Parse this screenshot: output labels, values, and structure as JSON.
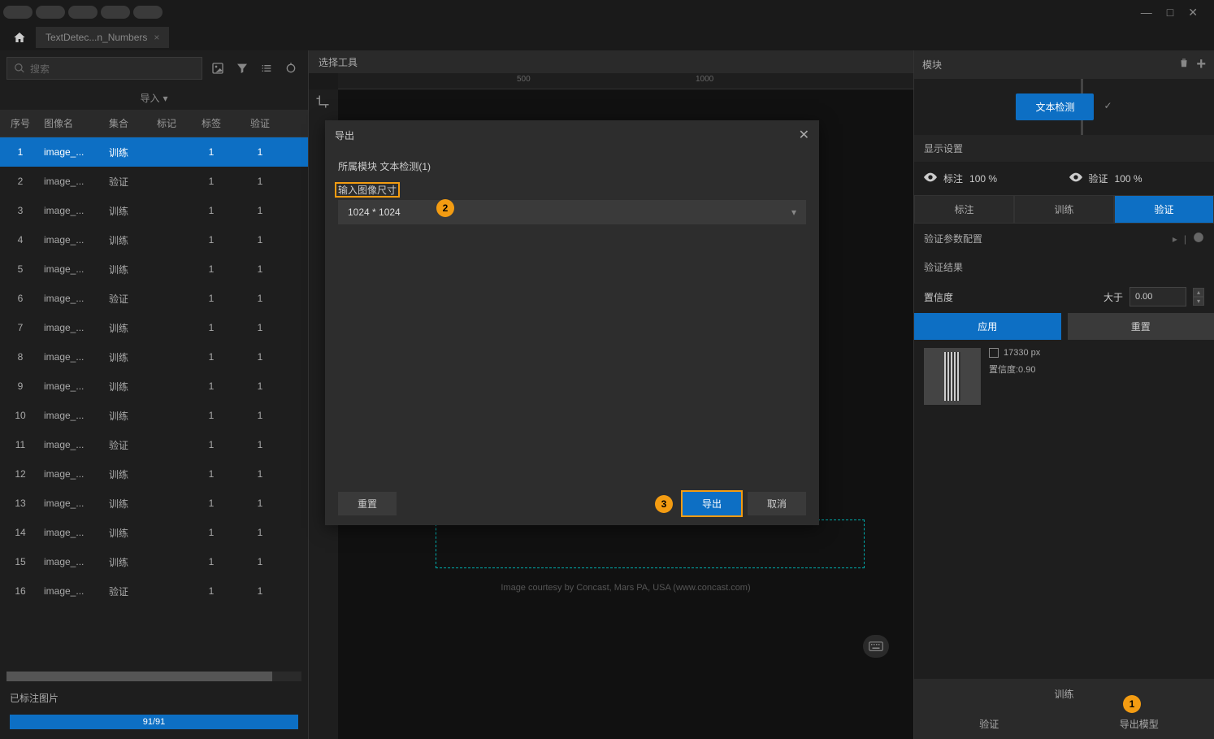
{
  "window": {
    "minimize_label": "—",
    "maximize_label": "□",
    "close_label": "✕"
  },
  "tabs": {
    "active": "TextDetec...n_Numbers"
  },
  "search": {
    "placeholder": "搜索"
  },
  "import_label": "导入",
  "table": {
    "headers": {
      "index": "序号",
      "name": "图像名",
      "set": "集合",
      "mark": "标记",
      "tag": "标签",
      "verify": "验证"
    },
    "rows": [
      {
        "idx": "1",
        "name": "image_...",
        "set": "训练",
        "tag": "1",
        "verify": "1",
        "selected": true
      },
      {
        "idx": "2",
        "name": "image_...",
        "set": "验证",
        "tag": "1",
        "verify": "1"
      },
      {
        "idx": "3",
        "name": "image_...",
        "set": "训练",
        "tag": "1",
        "verify": "1"
      },
      {
        "idx": "4",
        "name": "image_...",
        "set": "训练",
        "tag": "1",
        "verify": "1"
      },
      {
        "idx": "5",
        "name": "image_...",
        "set": "训练",
        "tag": "1",
        "verify": "1"
      },
      {
        "idx": "6",
        "name": "image_...",
        "set": "验证",
        "tag": "1",
        "verify": "1"
      },
      {
        "idx": "7",
        "name": "image_...",
        "set": "训练",
        "tag": "1",
        "verify": "1"
      },
      {
        "idx": "8",
        "name": "image_...",
        "set": "训练",
        "tag": "1",
        "verify": "1"
      },
      {
        "idx": "9",
        "name": "image_...",
        "set": "训练",
        "tag": "1",
        "verify": "1"
      },
      {
        "idx": "10",
        "name": "image_...",
        "set": "训练",
        "tag": "1",
        "verify": "1"
      },
      {
        "idx": "11",
        "name": "image_...",
        "set": "验证",
        "tag": "1",
        "verify": "1"
      },
      {
        "idx": "12",
        "name": "image_...",
        "set": "训练",
        "tag": "1",
        "verify": "1"
      },
      {
        "idx": "13",
        "name": "image_...",
        "set": "训练",
        "tag": "1",
        "verify": "1"
      },
      {
        "idx": "14",
        "name": "image_...",
        "set": "训练",
        "tag": "1",
        "verify": "1"
      },
      {
        "idx": "15",
        "name": "image_...",
        "set": "训练",
        "tag": "1",
        "verify": "1"
      },
      {
        "idx": "16",
        "name": "image_...",
        "set": "验证",
        "tag": "1",
        "verify": "1"
      }
    ]
  },
  "footer": {
    "labeled": "已标注图片",
    "progress": "91/91"
  },
  "center": {
    "header": "选择工具",
    "ruler_ticks": [
      "500",
      "1000"
    ],
    "credit": "Image courtesy by Concast, Mars PA, USA (www.concast.com)"
  },
  "right": {
    "header": "模块",
    "node": "文本检测",
    "display_settings": "显示设置",
    "annotation": "标注",
    "annotation_pct": "100 %",
    "verify_lbl": "验证",
    "verify_pct": "100 %",
    "tabs": {
      "annotate": "标注",
      "train": "训练",
      "verify": "验证"
    },
    "param_config": "验证参数配置",
    "result_title": "验证结果",
    "confidence_label": "置信度",
    "gt_label": "大于",
    "confidence_value": "0.00",
    "apply": "应用",
    "reset": "重置",
    "result_px": "17330 px",
    "result_conf": "置信度:0.90",
    "train_btn": "训练",
    "verify_btn": "验证",
    "export_btn": "导出模型"
  },
  "modal": {
    "title": "导出",
    "module_label": "所属模块 文本检测(1)",
    "size_label": "输入图像尺寸",
    "size_value": "1024 * 1024",
    "reset": "重置",
    "export": "导出",
    "cancel": "取消"
  },
  "callouts": {
    "c1": "1",
    "c2": "2",
    "c3": "3"
  }
}
